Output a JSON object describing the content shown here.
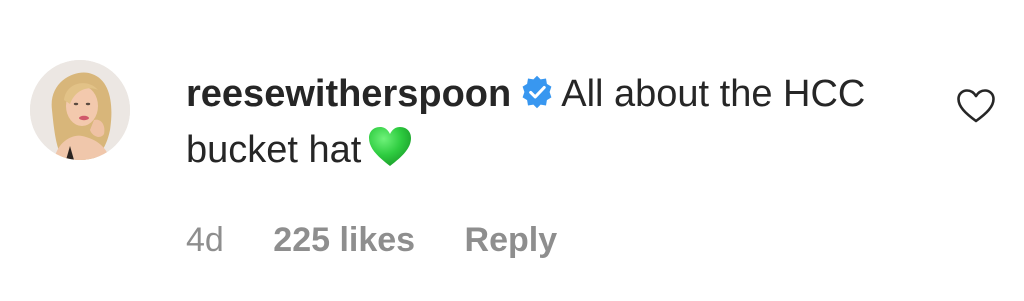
{
  "comment": {
    "username": "reesewitherspoon",
    "verified_icon": "verified-badge-icon",
    "verified_color": "#3897f0",
    "text": "All about the HCC bucket hat",
    "emoji_icon": "green-heart-emoji",
    "emoji_color": "#2ecc40",
    "like_icon": "heart-outline-icon",
    "avatar_icon": "profile-photo"
  },
  "meta": {
    "timestamp": "4d",
    "likes": "225 likes",
    "reply": "Reply"
  },
  "colors": {
    "text": "#262626",
    "secondary": "#8e8e8e"
  }
}
